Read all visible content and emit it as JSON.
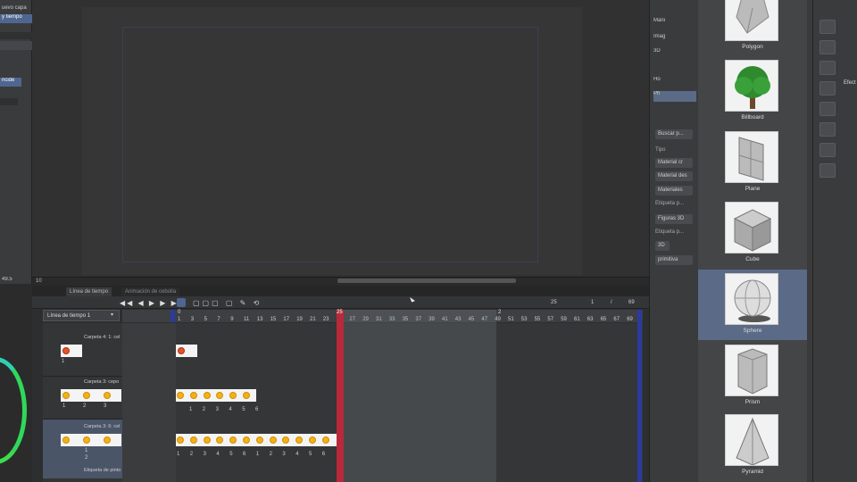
{
  "left_panel": {
    "items": [
      {
        "label": "uevo capa"
      },
      {
        "label": "y tiempo"
      },
      {
        "label": "ncide"
      }
    ],
    "zoom": "49.5"
  },
  "layers_panel": {
    "items": [
      {
        "label": "Mani"
      },
      {
        "label": "Imag"
      },
      {
        "label": "3D"
      },
      {
        "label": "Ho"
      },
      {
        "label": "Ph"
      }
    ],
    "search_placeholder": "Buscar p...",
    "type_label": "Tipo",
    "type_buttons": [
      "Material cr",
      "Material des",
      "Materiales"
    ],
    "tag_label_1": "Etiqueta p...",
    "tag_button_1": "Figuras 3D",
    "tag_label_2": "Etiqueta p...",
    "tag_button_2": "3D",
    "tag_button_3": "primitiva"
  },
  "materials": [
    {
      "label": "Polygon"
    },
    {
      "label": "Billboard"
    },
    {
      "label": "Plane"
    },
    {
      "label": "Cube"
    },
    {
      "label": "Sphere",
      "selected": true
    },
    {
      "label": "Prism"
    },
    {
      "label": "Pyramid"
    }
  ],
  "right_panel": {
    "text": "Efect"
  },
  "timeline": {
    "tabs": [
      "Línea de tiempo",
      "Animación de cebolla"
    ],
    "timeline_select": "Línea de tiempo 1",
    "current_frame": "25",
    "frame_counter": {
      "a": "1",
      "sep": "/",
      "b": "69"
    },
    "playhead_label": "25",
    "frame_rate_value": "10",
    "marker_start": "0",
    "marker_mid": "2",
    "ruler_ticks": [
      "1",
      "3",
      "5",
      "7",
      "9",
      "11",
      "13",
      "15",
      "17",
      "19",
      "21",
      "23",
      "25",
      "27",
      "29",
      "31",
      "33",
      "35",
      "37",
      "39",
      "41",
      "43",
      "45",
      "47",
      "49",
      "51",
      "53",
      "55",
      "57",
      "59",
      "61",
      "63",
      "65",
      "67",
      "69"
    ],
    "layers": [
      {
        "name": "Carpeta 4: 1: cel",
        "cels": [
          "1"
        ]
      },
      {
        "name": "Carpeta 3: cepo",
        "cels": [
          "1",
          "2",
          "3"
        ]
      },
      {
        "name": "Carpeta 3: 6: cel",
        "cels": [
          "1",
          "2"
        ],
        "sub": "Etiqueta de pinto"
      }
    ],
    "row2_nums": [
      "1",
      "2",
      "3",
      "4",
      "5",
      "6"
    ],
    "row3_nums": [
      "1",
      "2",
      "3",
      "4",
      "5",
      "6",
      "1",
      "2",
      "3",
      "4",
      "5",
      "6"
    ]
  },
  "colors": {
    "playhead": "#b8293a",
    "selection": "#5b6a86",
    "cel_yellow": "#f1b218",
    "marker_blue": "#2b3aa0"
  }
}
